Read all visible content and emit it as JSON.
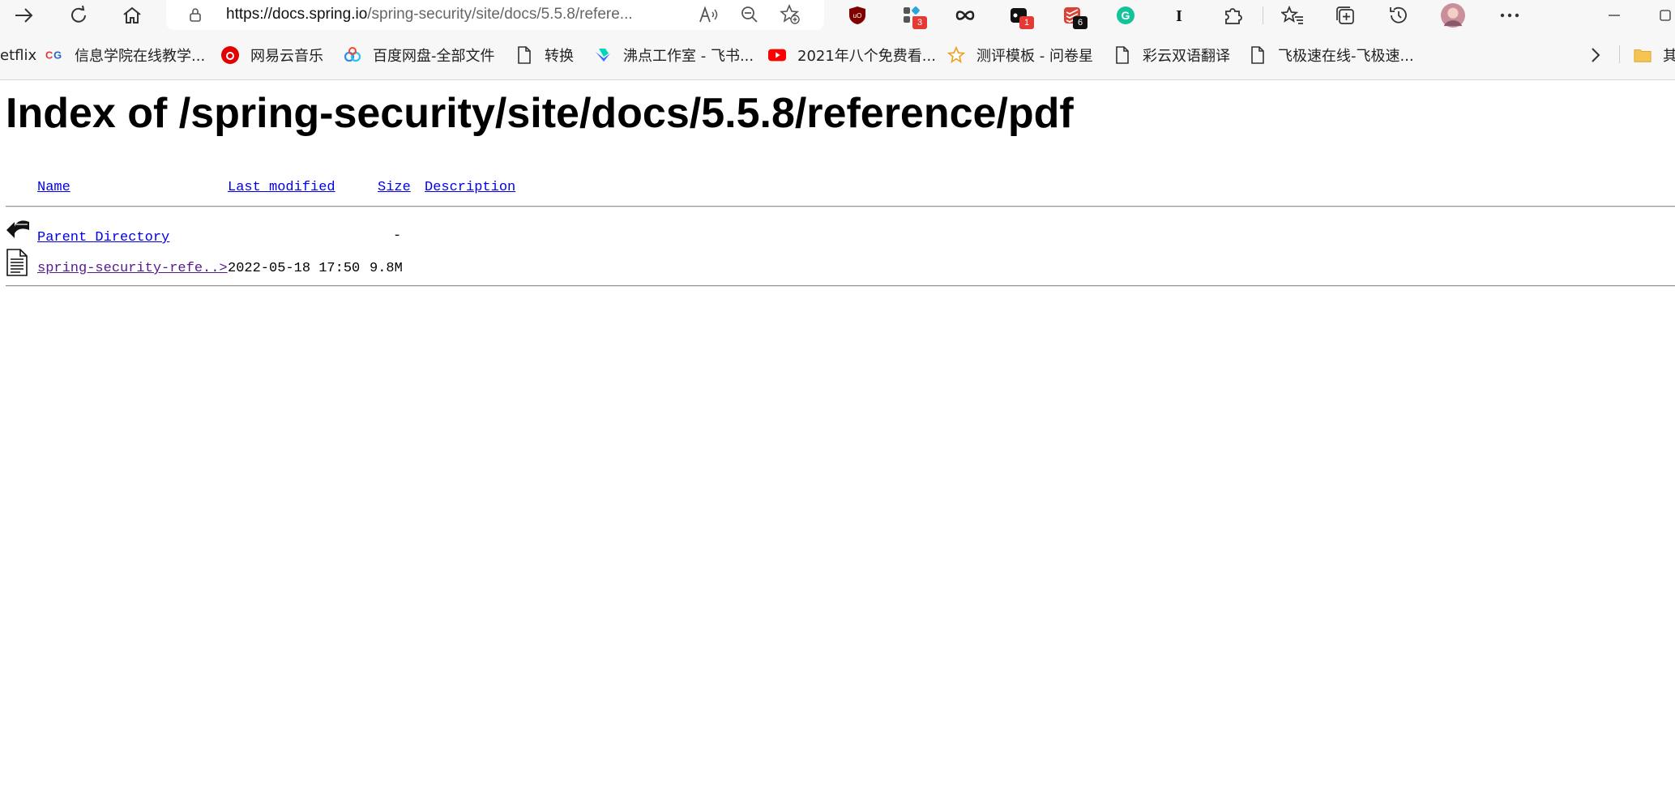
{
  "browser": {
    "url_host": "https://docs.spring.io",
    "url_path": "/spring-security/site/docs/5.5.8/refere...",
    "extensions": [
      {
        "name": "ublock-icon",
        "badge": ""
      },
      {
        "name": "extension-grid-icon",
        "badge": "3"
      },
      {
        "name": "infinity-icon",
        "badge": ""
      },
      {
        "name": "mask-icon",
        "badge": "1"
      },
      {
        "name": "todoist-icon",
        "badge": "6"
      },
      {
        "name": "grammarly-icon",
        "badge": ""
      },
      {
        "name": "instapaper-icon",
        "badge": ""
      }
    ]
  },
  "bookmarks": [
    {
      "label": "etflix",
      "icon": "netflix-icon"
    },
    {
      "label": "信息学院在线教学...",
      "icon": "cg-icon"
    },
    {
      "label": "网易云音乐",
      "icon": "netease-music-icon"
    },
    {
      "label": "百度网盘-全部文件",
      "icon": "baidu-pan-icon"
    },
    {
      "label": "转换",
      "icon": "page-icon"
    },
    {
      "label": "沸点工作室 - 飞书...",
      "icon": "feishu-icon"
    },
    {
      "label": "2021年八个免费看...",
      "icon": "youtube-icon"
    },
    {
      "label": "测评模板 - 问卷星",
      "icon": "star-icon"
    },
    {
      "label": "彩云双语翻译",
      "icon": "page-icon"
    },
    {
      "label": "飞极速在线-飞极速...",
      "icon": "page-icon"
    },
    {
      "label": "其",
      "icon": "folder-icon"
    }
  ],
  "page": {
    "title": "Index of /spring-security/site/docs/5.5.8/reference/pdf",
    "columns": {
      "name": "Name",
      "last_modified": "Last modified",
      "size": "Size",
      "description": "Description"
    },
    "rows": [
      {
        "name": "Parent Directory",
        "last_modified": "",
        "size": "-",
        "description": "",
        "icon": "back-arrow-icon"
      },
      {
        "name": "spring-security-refe..>",
        "last_modified": "2022-05-18 17:50",
        "size": "9.8M",
        "description": "",
        "icon": "document-icon"
      }
    ]
  }
}
